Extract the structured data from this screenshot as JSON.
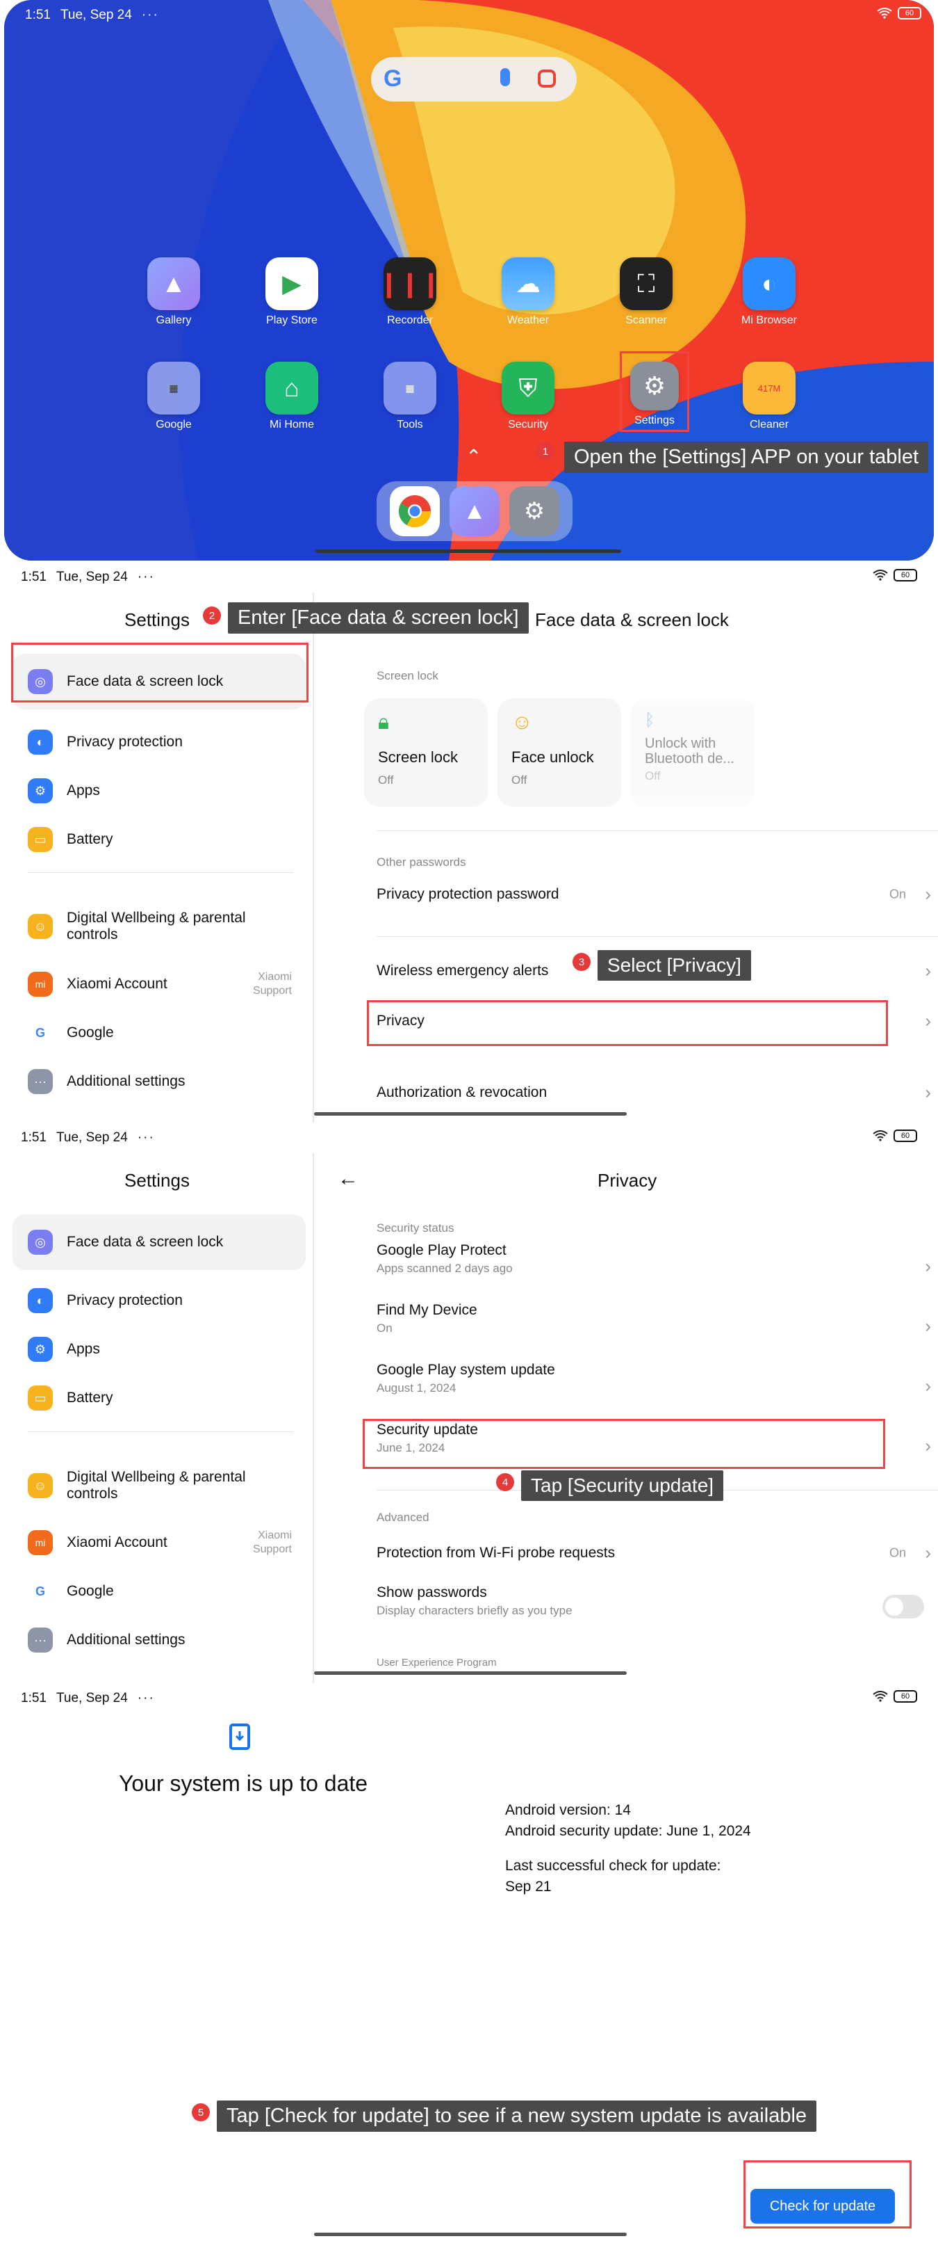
{
  "status": {
    "time": "1:51",
    "date": "Tue, Sep 24",
    "dots": "···",
    "battery": "60"
  },
  "home": {
    "apps_row1": [
      "Gallery",
      "Play Store",
      "Recorder",
      "Weather",
      "Scanner",
      "Mi Browser"
    ],
    "apps_row2": [
      "Google",
      "Mi Home",
      "Tools",
      "Security",
      "Settings",
      "Cleaner"
    ],
    "cleaner_badge": "417M",
    "google_g": "G"
  },
  "steps": [
    {
      "num": "1",
      "text": "Open the [Settings] APP on your tablet"
    },
    {
      "num": "2",
      "text": "Enter [Face data & screen lock]"
    },
    {
      "num": "3",
      "text": "Select [Privacy]"
    },
    {
      "num": "4",
      "text": "Tap [Security update]"
    },
    {
      "num": "5",
      "text": "Tap [Check for update] to see if a new system update is available"
    }
  ],
  "settings": {
    "title": "Settings",
    "items": [
      "Face data & screen lock",
      "Privacy protection",
      "Apps",
      "Battery",
      "Digital Wellbeing & parental controls",
      "Xiaomi Account",
      "Google",
      "Additional settings"
    ],
    "xiaomi_sub": "Xiaomi\nSupport"
  },
  "face": {
    "title": "Face data & screen lock",
    "screen_lock_section": "Screen lock",
    "cards": [
      {
        "title": "Screen lock",
        "status": "Off"
      },
      {
        "title": "Face unlock",
        "status": "Off"
      },
      {
        "title": "Unlock with Bluetooth de...",
        "status": "Off"
      }
    ],
    "other_passwords": "Other passwords",
    "privacy_protection_password": "Privacy protection password",
    "on": "On",
    "wireless_alerts": "Wireless emergency alerts",
    "privacy": "Privacy",
    "authorization": "Authorization & revocation"
  },
  "privacy": {
    "title": "Privacy",
    "security_status": "Security status",
    "rows": [
      {
        "title": "Google Play Protect",
        "sub": "Apps scanned 2 days ago"
      },
      {
        "title": "Find My Device",
        "sub": "On"
      },
      {
        "title": "Google Play system update",
        "sub": "August 1, 2024"
      },
      {
        "title": "Security update",
        "sub": "June 1, 2024"
      }
    ],
    "advanced": "Advanced",
    "wifi_probe": "Protection from Wi-Fi probe requests",
    "on": "On",
    "show_passwords": "Show passwords",
    "show_passwords_sub": "Display characters briefly as you type",
    "user_experience": "User Experience Program"
  },
  "update": {
    "title": "Your system is up to date",
    "android_version": "Android version: 14",
    "security_update": "Android security update: June 1, 2024",
    "last_check_label": "Last successful check for update:",
    "last_check_date": "Sep 21",
    "check_button": "Check for update"
  }
}
